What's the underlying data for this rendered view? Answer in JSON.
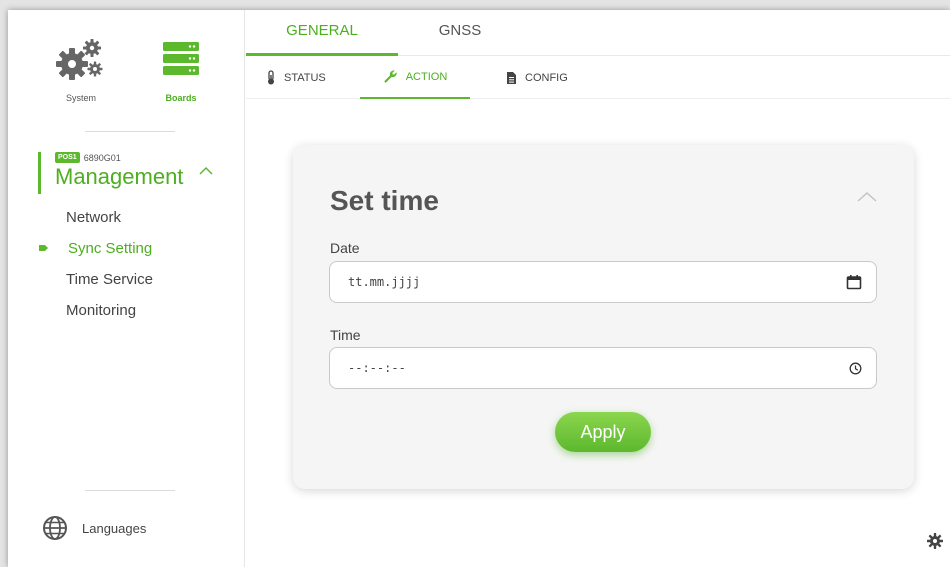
{
  "sidebar": {
    "system_label": "System",
    "boards_label": "Boards",
    "board": {
      "badge": "POS1",
      "id": "6890G01",
      "title": "Management"
    },
    "menu": [
      {
        "label": "Network",
        "active": false
      },
      {
        "label": "Sync Setting",
        "active": true
      },
      {
        "label": "Time Service",
        "active": false
      },
      {
        "label": "Monitoring",
        "active": false
      }
    ],
    "languages_label": "Languages"
  },
  "tabs": {
    "primary": [
      {
        "label": "GENERAL",
        "active": true
      },
      {
        "label": "GNSS",
        "active": false
      }
    ],
    "secondary": [
      {
        "label": "STATUS",
        "icon": "thermometer-icon",
        "active": false
      },
      {
        "label": "ACTION",
        "icon": "wrench-icon",
        "active": true
      },
      {
        "label": "CONFIG",
        "icon": "document-icon",
        "active": false
      }
    ]
  },
  "card": {
    "title": "Set time",
    "date_label": "Date",
    "date_placeholder": "tt.mm.jjjj",
    "time_label": "Time",
    "time_placeholder": "--:--:--",
    "apply_label": "Apply"
  },
  "colors": {
    "accent": "#5cb82d",
    "accent_text": "#4caf1f",
    "card_bg": "#f5f5f5"
  }
}
